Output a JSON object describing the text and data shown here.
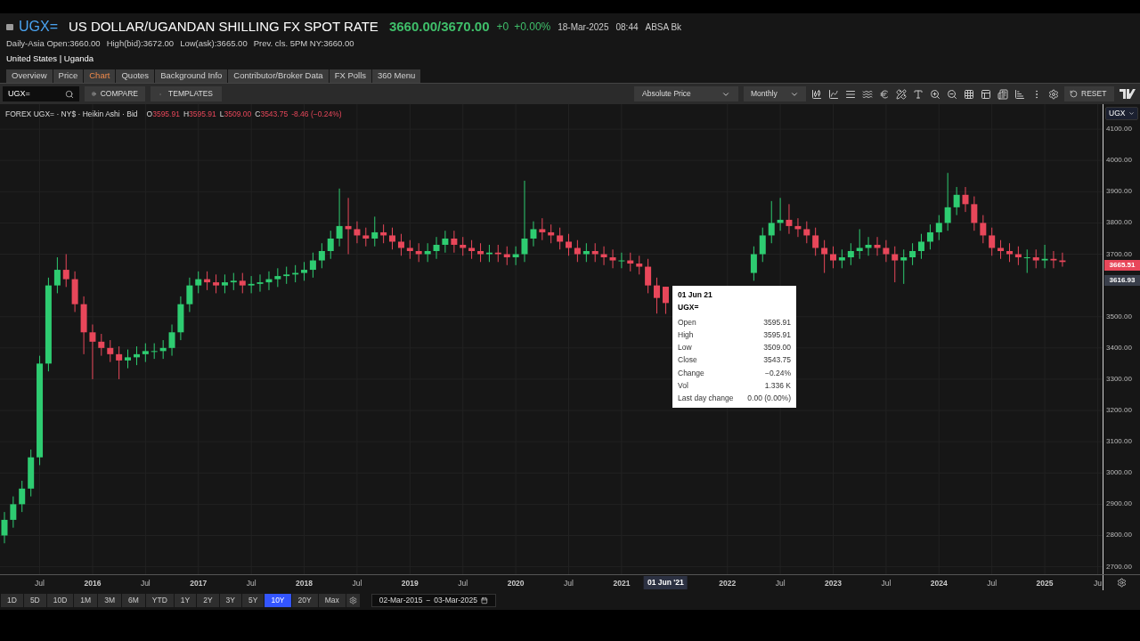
{
  "header": {
    "ric": "UGX=",
    "title": "US DOLLAR/UGANDAN SHILLING FX SPOT RATE",
    "price": "3660.00/3670.00",
    "change": "+0",
    "change_pct": "+0.00%",
    "date": "18-Mar-2025",
    "time": "08:44",
    "source": "ABSA Bk",
    "info": [
      "Daily-Asia Open:3660.00",
      "High(bid):3672.00",
      "Low(ask):3665.00",
      "Prev. cls. 5PM NY:3660.00"
    ],
    "location": "United States | Uganda"
  },
  "tabs": [
    {
      "label": "Overview",
      "selected": false
    },
    {
      "label": "Price",
      "selected": false
    },
    {
      "label": "Chart",
      "selected": true
    },
    {
      "label": "Quotes",
      "selected": false
    },
    {
      "label": "Background Info",
      "selected": false
    },
    {
      "label": "Contributor/Broker Data",
      "selected": false
    },
    {
      "label": "FX Polls",
      "selected": false
    },
    {
      "label": "360 Menu",
      "selected": false
    }
  ],
  "toolbar": {
    "search_value": "UGX=",
    "compare": "COMPARE",
    "templates": "TEMPLATES",
    "price_type": "Absolute Price",
    "interval": "Monthly",
    "reset": "RESET"
  },
  "legend": {
    "values": [
      {
        "key": "O",
        "value": "3595.91"
      },
      {
        "key": "H",
        "value": "3595.91"
      },
      {
        "key": "L",
        "value": "3509.00"
      },
      {
        "key": "C",
        "value": "3543.75"
      }
    ],
    "change": "-8.46 (−0.24%)"
  },
  "currency_selector": "UGX",
  "chart_data": {
    "type": "candlestick",
    "title": "FOREX UGX= · NY$ · Heikin Ashi · Bid",
    "ylim": [
      2676,
      4180
    ],
    "xlim": [
      2015.125,
      2025.9
    ],
    "grid": true,
    "yticks": [
      {
        "value": 4100,
        "label": "4100.00"
      },
      {
        "value": 4000,
        "label": "4000.00"
      },
      {
        "value": 3900,
        "label": "3900.00"
      },
      {
        "value": 3800,
        "label": "3800.00"
      },
      {
        "value": 3700,
        "label": "3700.00"
      },
      {
        "value": 3500,
        "label": "3500.00"
      },
      {
        "value": 3400,
        "label": "3400.00"
      },
      {
        "value": 3300,
        "label": "3300.00"
      },
      {
        "value": 3200,
        "label": "3200.00"
      },
      {
        "value": 3100,
        "label": "3100.00"
      },
      {
        "value": 3000,
        "label": "3000.00"
      },
      {
        "value": 2900,
        "label": "2900.00"
      },
      {
        "value": 2800,
        "label": "2800.00"
      },
      {
        "value": 2700,
        "label": "2700.00"
      }
    ],
    "xticks": [
      {
        "value": 2015.5,
        "label": "Jul"
      },
      2016,
      {
        "value": 2016.5,
        "label": "Jul"
      },
      2017,
      {
        "value": 2017.5,
        "label": "Jul"
      },
      2018,
      {
        "value": 2018.5,
        "label": "Jul"
      },
      2019,
      {
        "value": 2019.5,
        "label": "Jul"
      },
      2020,
      {
        "value": 2020.5,
        "label": "Jul"
      },
      2021,
      2022,
      {
        "value": 2022.5,
        "label": "Jul"
      },
      2023,
      {
        "value": 2023.5,
        "label": "Jul"
      },
      2024,
      {
        "value": 2024.5,
        "label": "Jul"
      },
      2025,
      {
        "value": 2025.5,
        "label": "Ju"
      }
    ],
    "x": [
      2015.167,
      2015.25,
      2015.333,
      2015.417,
      2015.5,
      2015.583,
      2015.667,
      2015.75,
      2015.833,
      2015.917,
      2016,
      2016.083,
      2016.167,
      2016.25,
      2016.333,
      2016.417,
      2016.5,
      2016.583,
      2016.667,
      2016.75,
      2016.833,
      2016.917,
      2017,
      2017.083,
      2017.167,
      2017.25,
      2017.333,
      2017.417,
      2017.5,
      2017.583,
      2017.667,
      2017.75,
      2017.833,
      2017.917,
      2018,
      2018.083,
      2018.167,
      2018.25,
      2018.333,
      2018.417,
      2018.5,
      2018.583,
      2018.667,
      2018.75,
      2018.833,
      2018.917,
      2019,
      2019.083,
      2019.167,
      2019.25,
      2019.333,
      2019.417,
      2019.5,
      2019.583,
      2019.667,
      2019.75,
      2019.833,
      2019.917,
      2020,
      2020.083,
      2020.167,
      2020.25,
      2020.333,
      2020.417,
      2020.5,
      2020.583,
      2020.667,
      2020.75,
      2020.833,
      2020.917,
      2021,
      2021.083,
      2021.167,
      2021.25,
      2021.333,
      2021.417,
      null,
      null,
      null,
      null,
      null,
      null,
      null,
      null,
      null,
      2022.25,
      2022.333,
      2022.417,
      2022.5,
      2022.583,
      2022.667,
      2022.75,
      2022.833,
      2022.917,
      2023,
      2023.083,
      2023.167,
      2023.25,
      2023.333,
      2023.417,
      2023.5,
      2023.583,
      2023.667,
      2023.75,
      2023.833,
      2023.917,
      2024,
      2024.083,
      2024.167,
      2024.25,
      2024.333,
      2024.417,
      2024.5,
      2024.583,
      2024.667,
      2024.75,
      2024.833,
      2024.917,
      2025,
      2025.083,
      2025.167
    ],
    "ohlc": [
      [
        2800,
        2875,
        2775,
        2850
      ],
      [
        2850,
        2925,
        2825,
        2900
      ],
      [
        2900,
        2975,
        2875,
        2950
      ],
      [
        2950,
        3075,
        2925,
        3050
      ],
      [
        3050,
        3375,
        3025,
        3350
      ],
      [
        3350,
        3625,
        3325,
        3600
      ],
      [
        3600,
        3690,
        3575,
        3650
      ],
      [
        3650,
        3700,
        3595,
        3620
      ],
      [
        3620,
        3645,
        3515,
        3540
      ],
      [
        3540,
        3565,
        3380,
        3450
      ],
      [
        3450,
        3475,
        3300,
        3420
      ],
      [
        3420,
        3445,
        3375,
        3400
      ],
      [
        3400,
        3425,
        3355,
        3380
      ],
      [
        3380,
        3405,
        3300,
        3360
      ],
      [
        3360,
        3395,
        3335,
        3370
      ],
      [
        3370,
        3405,
        3345,
        3380
      ],
      [
        3380,
        3415,
        3355,
        3390
      ],
      [
        3390,
        3415,
        3365,
        3390
      ],
      [
        3390,
        3425,
        3365,
        3400
      ],
      [
        3400,
        3475,
        3375,
        3450
      ],
      [
        3450,
        3565,
        3425,
        3540
      ],
      [
        3540,
        3625,
        3515,
        3600
      ],
      [
        3600,
        3645,
        3575,
        3620
      ],
      [
        3620,
        3645,
        3585,
        3610
      ],
      [
        3610,
        3635,
        3575,
        3600
      ],
      [
        3600,
        3635,
        3575,
        3610
      ],
      [
        3610,
        3640,
        3585,
        3615
      ],
      [
        3615,
        3640,
        3575,
        3600
      ],
      [
        3600,
        3630,
        3575,
        3605
      ],
      [
        3605,
        3635,
        3580,
        3610
      ],
      [
        3610,
        3645,
        3585,
        3620
      ],
      [
        3620,
        3655,
        3595,
        3630
      ],
      [
        3630,
        3660,
        3605,
        3635
      ],
      [
        3635,
        3665,
        3610,
        3640
      ],
      [
        3640,
        3675,
        3615,
        3650
      ],
      [
        3650,
        3705,
        3625,
        3680
      ],
      [
        3680,
        3735,
        3655,
        3710
      ],
      [
        3710,
        3775,
        3685,
        3750
      ],
      [
        3750,
        3910,
        3725,
        3790
      ],
      [
        3790,
        3880,
        3700,
        3780
      ],
      [
        3780,
        3805,
        3735,
        3760
      ],
      [
        3760,
        3785,
        3725,
        3750
      ],
      [
        3750,
        3820,
        3725,
        3770
      ],
      [
        3770,
        3795,
        3735,
        3760
      ],
      [
        3760,
        3785,
        3715,
        3740
      ],
      [
        3740,
        3765,
        3695,
        3720
      ],
      [
        3720,
        3745,
        3685,
        3710
      ],
      [
        3710,
        3735,
        3675,
        3700
      ],
      [
        3700,
        3735,
        3675,
        3710
      ],
      [
        3710,
        3755,
        3685,
        3730
      ],
      [
        3730,
        3775,
        3705,
        3750
      ],
      [
        3750,
        3775,
        3705,
        3730
      ],
      [
        3730,
        3755,
        3695,
        3720
      ],
      [
        3720,
        3745,
        3685,
        3710
      ],
      [
        3710,
        3735,
        3675,
        3700
      ],
      [
        3700,
        3730,
        3675,
        3705
      ],
      [
        3705,
        3730,
        3675,
        3700
      ],
      [
        3700,
        3725,
        3665,
        3690
      ],
      [
        3690,
        3725,
        3665,
        3700
      ],
      [
        3700,
        3935,
        3675,
        3750
      ],
      [
        3750,
        3805,
        3725,
        3780
      ],
      [
        3780,
        3815,
        3745,
        3770
      ],
      [
        3770,
        3795,
        3735,
        3760
      ],
      [
        3760,
        3785,
        3715,
        3740
      ],
      [
        3740,
        3765,
        3695,
        3720
      ],
      [
        3720,
        3745,
        3675,
        3700
      ],
      [
        3700,
        3735,
        3675,
        3710
      ],
      [
        3710,
        3735,
        3675,
        3700
      ],
      [
        3700,
        3725,
        3665,
        3690
      ],
      [
        3690,
        3715,
        3655,
        3680
      ],
      [
        3680,
        3705,
        3655,
        3680
      ],
      [
        3680,
        3705,
        3645,
        3670
      ],
      [
        3670,
        3695,
        3635,
        3660
      ],
      [
        3660,
        3685,
        3575,
        3600
      ],
      [
        3600,
        3625,
        3510,
        3560
      ],
      [
        3595.91,
        3595.91,
        3509.0,
        3543.75
      ],
      null,
      null,
      null,
      null,
      null,
      null,
      null,
      null,
      null,
      [
        3640,
        3725,
        3615,
        3700
      ],
      [
        3700,
        3785,
        3675,
        3760
      ],
      [
        3760,
        3870,
        3735,
        3800
      ],
      [
        3800,
        3880,
        3775,
        3810
      ],
      [
        3810,
        3860,
        3765,
        3790
      ],
      [
        3790,
        3815,
        3755,
        3780
      ],
      [
        3780,
        3805,
        3735,
        3760
      ],
      [
        3760,
        3785,
        3695,
        3720
      ],
      [
        3720,
        3745,
        3640,
        3700
      ],
      [
        3700,
        3725,
        3655,
        3680
      ],
      [
        3680,
        3715,
        3655,
        3690
      ],
      [
        3690,
        3735,
        3665,
        3710
      ],
      [
        3710,
        3780,
        3685,
        3720
      ],
      [
        3720,
        3755,
        3695,
        3730
      ],
      [
        3730,
        3755,
        3695,
        3720
      ],
      [
        3720,
        3745,
        3675,
        3700
      ],
      [
        3700,
        3725,
        3610,
        3680
      ],
      [
        3680,
        3715,
        3605,
        3690
      ],
      [
        3690,
        3735,
        3665,
        3710
      ],
      [
        3710,
        3765,
        3685,
        3740
      ],
      [
        3740,
        3795,
        3715,
        3770
      ],
      [
        3770,
        3825,
        3745,
        3800
      ],
      [
        3800,
        3960,
        3775,
        3850
      ],
      [
        3850,
        3915,
        3825,
        3890
      ],
      [
        3890,
        3915,
        3835,
        3860
      ],
      [
        3860,
        3885,
        3775,
        3800
      ],
      [
        3800,
        3825,
        3735,
        3760
      ],
      [
        3760,
        3785,
        3695,
        3720
      ],
      [
        3720,
        3745,
        3685,
        3710
      ],
      [
        3710,
        3735,
        3675,
        3700
      ],
      [
        3700,
        3725,
        3665,
        3690
      ],
      [
        3690,
        3715,
        3640,
        3690
      ],
      [
        3690,
        3715,
        3655,
        3680
      ],
      [
        3680,
        3730,
        3655,
        3685
      ],
      [
        3685,
        3710,
        3655,
        3680
      ],
      [
        3680,
        3705,
        3660,
        3675
      ]
    ]
  },
  "crosshair": {
    "date": "01 Jun '21"
  },
  "price_labels": [
    {
      "text": "3665.51",
      "color": "#e8475a"
    },
    {
      "text": "3616.93",
      "color": "#3a3f4b"
    }
  ],
  "tooltip": {
    "date": "01 Jun 21",
    "ric": "UGX=",
    "rows": [
      {
        "label": "Open",
        "value": "3595.91"
      },
      {
        "label": "High",
        "value": "3595.91"
      },
      {
        "label": "Low",
        "value": "3509.00"
      },
      {
        "label": "Close",
        "value": "3543.75"
      },
      {
        "label": "Change",
        "value": "−0.24%"
      },
      {
        "label": "Vol",
        "value": "1.336 K"
      },
      {
        "label": "Last day change",
        "value": "0.00 (0.00%)"
      }
    ]
  },
  "ranges": [
    {
      "label": "1D",
      "selected": false
    },
    {
      "label": "5D",
      "selected": false
    },
    {
      "label": "10D",
      "selected": false
    },
    {
      "label": "1M",
      "selected": false
    },
    {
      "label": "3M",
      "selected": false
    },
    {
      "label": "6M",
      "selected": false
    },
    {
      "label": "YTD",
      "selected": false
    },
    {
      "label": "1Y",
      "selected": false
    },
    {
      "label": "2Y",
      "selected": false
    },
    {
      "label": "3Y",
      "selected": false
    },
    {
      "label": "5Y",
      "selected": false
    },
    {
      "label": "10Y",
      "selected": true
    },
    {
      "label": "20Y",
      "selected": false
    },
    {
      "label": "Max",
      "selected": false
    }
  ],
  "date_range": {
    "from": "02-Mar-2015",
    "separator": "−",
    "to": "03-Mar-2025"
  }
}
